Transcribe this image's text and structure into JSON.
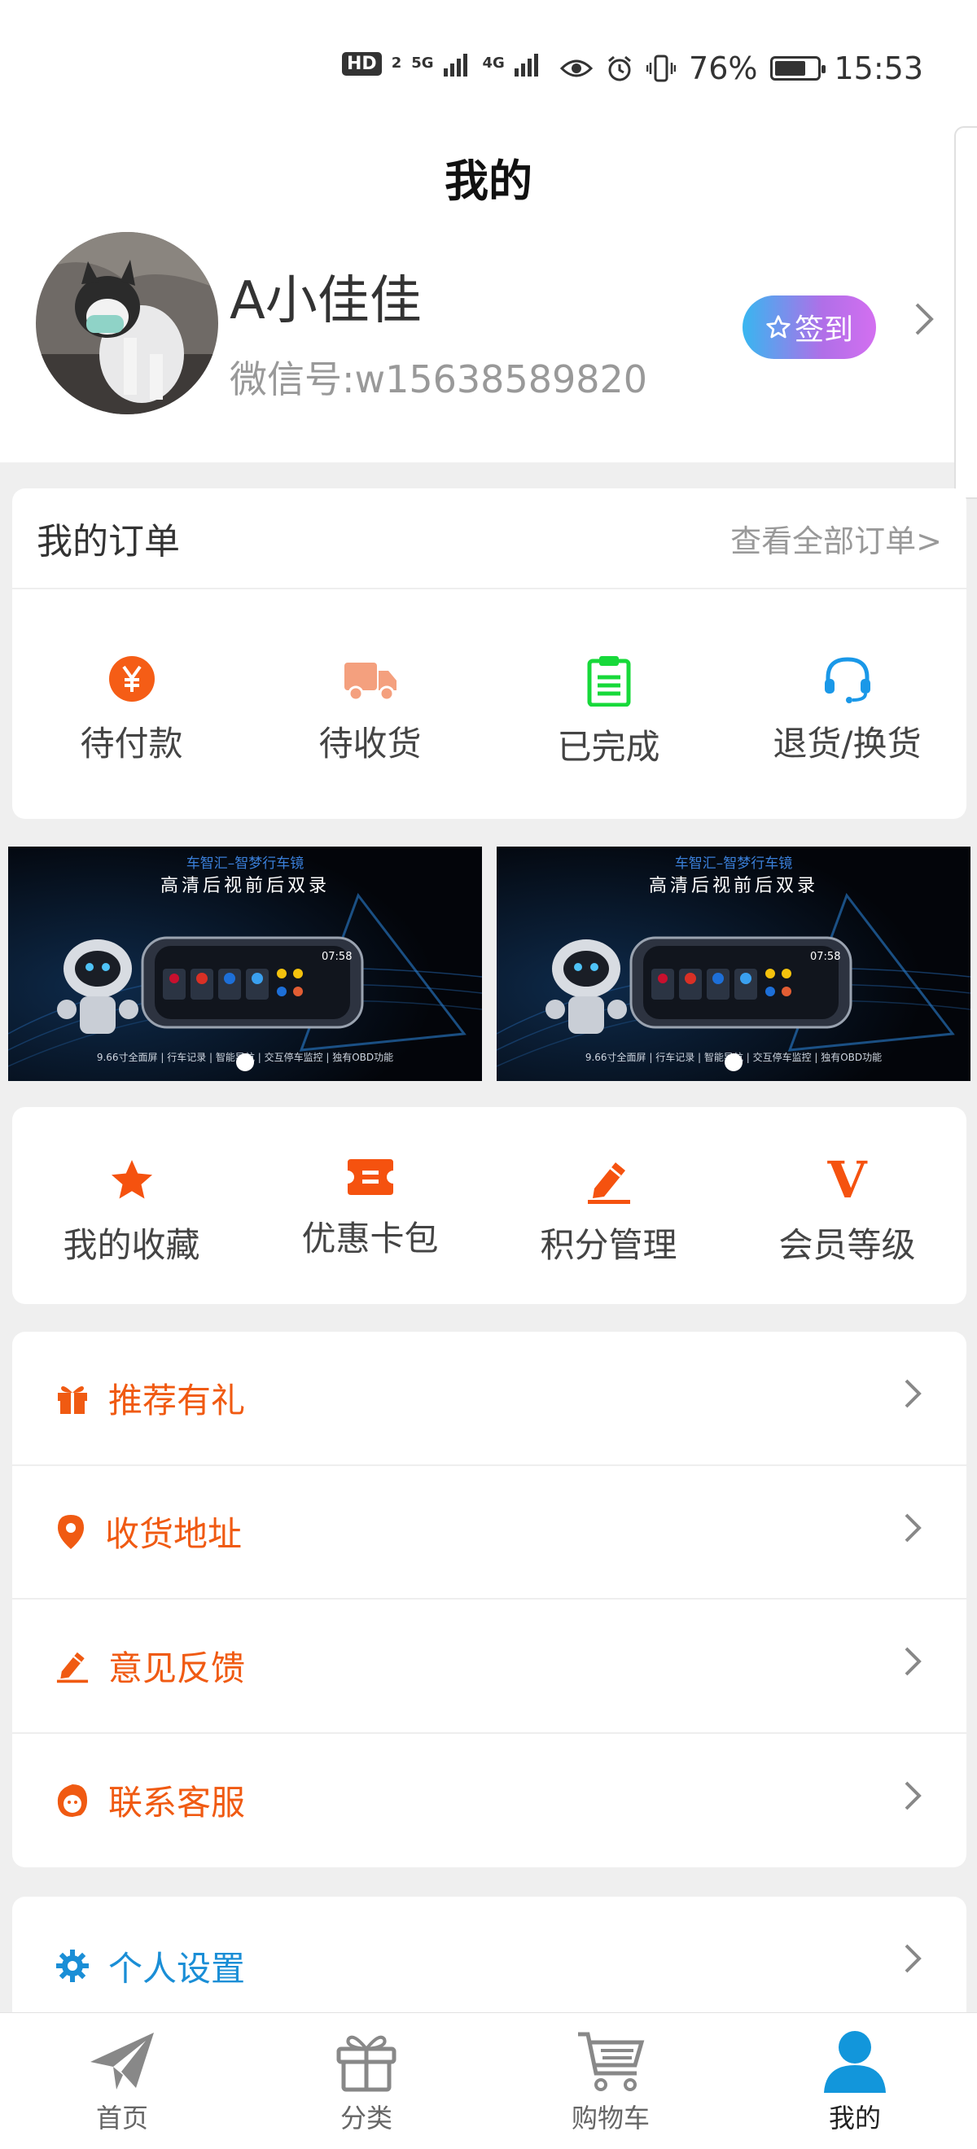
{
  "status_bar": {
    "hd_label": "HD",
    "hd_sub": "2",
    "net1": "5G",
    "net2": "4G",
    "battery_percent": "76%",
    "battery_level": 0.76,
    "time": "15:53"
  },
  "header": {
    "title": "我的",
    "username": "A小佳佳",
    "wechat_id": "微信号:w15638589820",
    "signin_label": "签到"
  },
  "orders": {
    "title": "我的订单",
    "view_all": "查看全部订单>",
    "items": [
      {
        "label": "待付款",
        "icon": "yen-icon"
      },
      {
        "label": "待收货",
        "icon": "truck-icon"
      },
      {
        "label": "已完成",
        "icon": "clipboard-icon"
      },
      {
        "label": "退货/换货",
        "icon": "headset-icon"
      }
    ]
  },
  "banners": [
    {
      "brand": "车智汇–智梦行车镜",
      "title": "高清后视前后双录",
      "screen_time": "07:58",
      "footer": "9.66寸全面屏 | 行车记录 | 智能导航 | 交互停车监控 | 独有OBD功能"
    },
    {
      "brand": "车智汇–智梦行车镜",
      "title": "高清后视前后双录",
      "screen_time": "07:58",
      "footer": "9.66寸全面屏 | 行车记录 | 智能导航 | 交互停车监控 | 独有OBD功能"
    }
  ],
  "tools": {
    "items": [
      {
        "label": "我的收藏",
        "icon": "star-icon"
      },
      {
        "label": "优惠卡包",
        "icon": "coupon-icon"
      },
      {
        "label": "积分管理",
        "icon": "pencil-icon"
      },
      {
        "label": "会员等级",
        "icon": "vip-icon",
        "glyph": "V"
      }
    ]
  },
  "menu": {
    "items": [
      {
        "label": "推荐有礼",
        "icon": "gift-icon"
      },
      {
        "label": "收货地址",
        "icon": "location-pin-icon"
      },
      {
        "label": "意见反馈",
        "icon": "edit-icon"
      },
      {
        "label": "联系客服",
        "icon": "service-agent-icon"
      }
    ],
    "settings_label": "个人设置"
  },
  "tabbar": {
    "items": [
      {
        "label": "首页",
        "icon": "paper-plane-icon"
      },
      {
        "label": "分类",
        "icon": "gift-box-icon"
      },
      {
        "label": "购物车",
        "icon": "cart-icon"
      },
      {
        "label": "我的",
        "icon": "user-icon"
      }
    ],
    "active_index": 3
  },
  "colors": {
    "accent_orange": "#f05a12",
    "accent_blue": "#1a8ed6",
    "tab_active": "#1296db"
  }
}
